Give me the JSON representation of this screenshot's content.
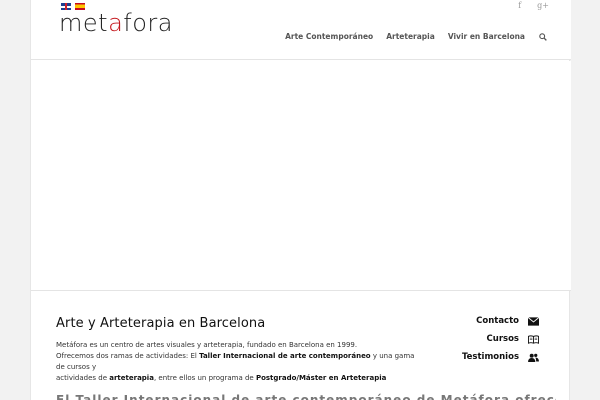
{
  "header": {
    "languages": [
      {
        "name": "English",
        "icon": "flag-uk-icon"
      },
      {
        "name": "Español",
        "icon": "flag-es-icon"
      }
    ],
    "social": [
      {
        "label": "f",
        "icon": "facebook-icon"
      },
      {
        "label": "g+",
        "icon": "google-plus-icon"
      }
    ],
    "logo": {
      "part1": "met",
      "accent": "a",
      "part2": "fora",
      "accent_color": "#c4161c"
    },
    "nav": [
      {
        "label": "Arte Contemporáneo"
      },
      {
        "label": "Arteterapia"
      },
      {
        "label": "Vivir en Barcelona"
      }
    ],
    "search_icon": "search-icon"
  },
  "main": {
    "title": "Arte y Arteterapia en Barcelona",
    "line1": "Metáfora es un centro de artes visuales y arteterapia, fundado en Barcelona en 1999.",
    "line2_a": "Ofrecemos dos ramas de actividades: El ",
    "line2_b": "Taller Internacional de arte contemporáneo",
    "line2_c": " y una gama de cursos y",
    "line3_a": "actividades de ",
    "line3_b": "arteterapia",
    "line3_c": ", entre ellos un programa de ",
    "line3_d": "Postgrado/Máster en Arteterapia"
  },
  "sidebar": {
    "items": [
      {
        "label": "Contacto",
        "icon": "envelope-icon"
      },
      {
        "label": "Cursos",
        "icon": "book-icon"
      },
      {
        "label": "Testimonios",
        "icon": "users-icon"
      }
    ]
  },
  "footer_fragment": "El Taller Internacional de arte contemporáneo de Metáfora ofrece"
}
